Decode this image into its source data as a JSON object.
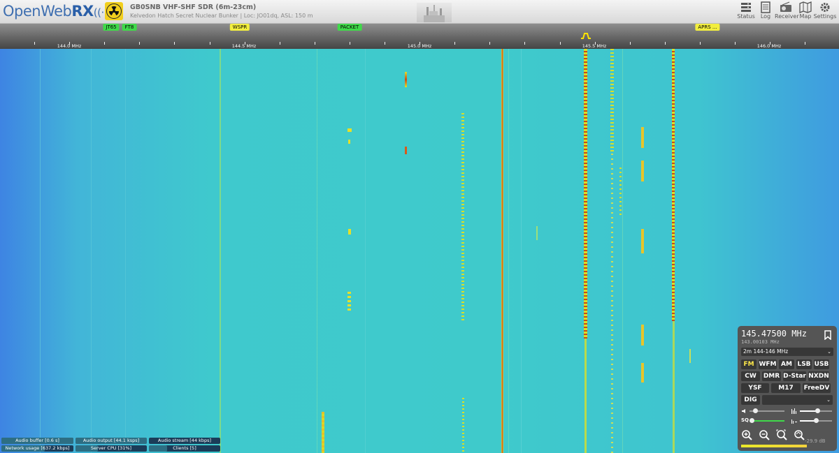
{
  "header": {
    "logo_text": "OpenWeb",
    "logo_bold": "RX",
    "receiver_name": "GB0SNB VHF-SHF SDR (6m-23cm)",
    "receiver_desc": "Kelvedon Hatch Secret Nuclear Bunker | Loc: JO01dq, ASL: 150 m",
    "nav": [
      {
        "label": "Status",
        "icon": "status-icon"
      },
      {
        "label": "Log",
        "icon": "log-icon"
      },
      {
        "label": "Receiver",
        "icon": "receiver-icon"
      },
      {
        "label": "Map",
        "icon": "map-icon"
      },
      {
        "label": "Settings",
        "icon": "settings-icon"
      }
    ]
  },
  "scale": {
    "bookmarks": [
      {
        "label": "JT65",
        "color": "green"
      },
      {
        "label": "FT8",
        "color": "green"
      },
      {
        "label": "WSPR",
        "color": "yellow"
      },
      {
        "label": "PACKET",
        "color": "green"
      },
      {
        "label": "APRS ...",
        "color": "yellow"
      }
    ],
    "labels": [
      "144.0 MHz",
      "144.5 MHz",
      "145.0 MHz",
      "145.5 MHz",
      "146.0 MHz"
    ]
  },
  "status_bars": [
    {
      "label": "Audio buffer [0.6 s]",
      "level": 0.35
    },
    {
      "label": "Audio output [44.1 ksps]",
      "level": 1.0
    },
    {
      "label": "Audio stream [44 kbps]",
      "level": 0.4
    },
    {
      "label": "Network usage [637.2 kbps]",
      "level": 0.6
    },
    {
      "label": "Server CPU [31%]",
      "level": 0.31
    },
    {
      "label": "Clients [5]",
      "level": 0.25
    }
  ],
  "panel": {
    "frequency": "145.47500 MHz",
    "offset_frequency": "143.00103 MHz",
    "profile": "2m 144-146 MHz",
    "modes_row1": [
      "FM",
      "WFM",
      "AM",
      "LSB",
      "USB"
    ],
    "modes_row2": [
      "CW",
      "DMR",
      "D-Star",
      "NXDN"
    ],
    "modes_row3": [
      "YSF",
      "M17",
      "FreeDV"
    ],
    "digital_label": "DIG",
    "active_mode": "FM",
    "volume_level": 0.15,
    "nr_level": 0.55,
    "squelch_level": 0.05,
    "nr2_level": 0.5,
    "smeter_value": "-29.9 dB",
    "smeter_level": 0.72
  }
}
